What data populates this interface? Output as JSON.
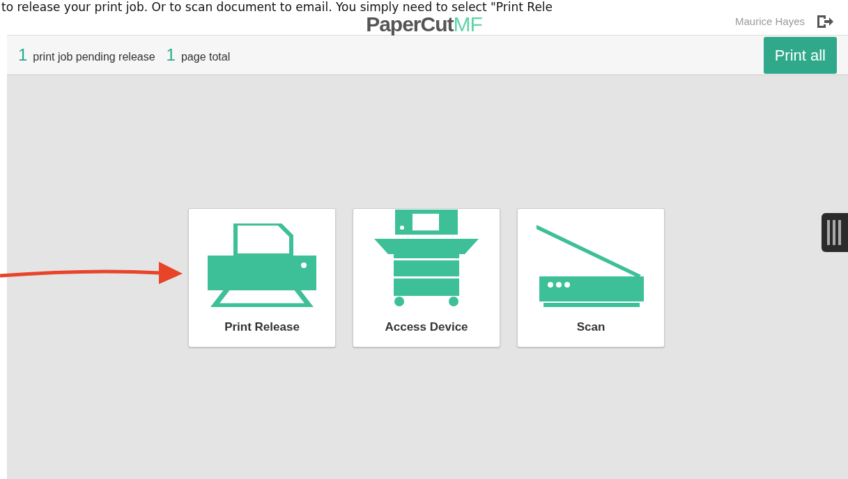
{
  "document_text": "to release your print job. Or to scan document to email. You simply need to select \"Print Rele",
  "header": {
    "logo_main": "PaperCut",
    "logo_suffix": "MF",
    "user_name": "Maurice Hayes"
  },
  "summary": {
    "job_count": "1",
    "job_label": "print job pending release",
    "page_count": "1",
    "page_label": "page total",
    "button": "Print all"
  },
  "tiles": [
    {
      "kind": "printer",
      "label": "Print Release"
    },
    {
      "kind": "copier",
      "label": "Access Device"
    },
    {
      "kind": "scanner",
      "label": "Scan"
    }
  ]
}
